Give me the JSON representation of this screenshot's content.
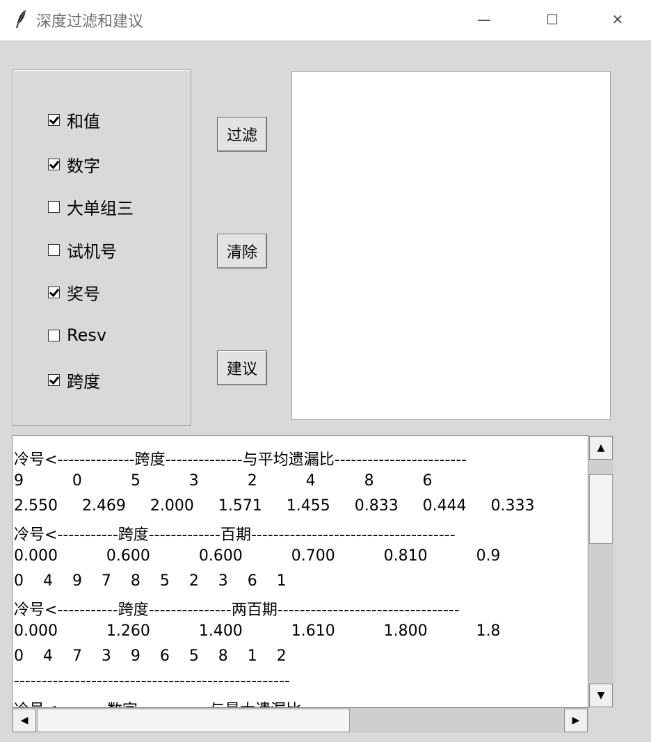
{
  "window": {
    "title": "深度过滤和建议",
    "min_symbol": "—",
    "max_symbol": "☐",
    "close_symbol": "✕",
    "icon": "feather-icon"
  },
  "options": [
    {
      "label": "和值",
      "checked": true
    },
    {
      "label": "数字",
      "checked": true
    },
    {
      "label": "大单组三",
      "checked": false
    },
    {
      "label": "试机号",
      "checked": false
    },
    {
      "label": "奖号",
      "checked": true
    },
    {
      "label": "Resv",
      "checked": false
    },
    {
      "label": "跨度",
      "checked": true
    }
  ],
  "buttons": {
    "filter": "过滤",
    "clear": "清除",
    "suggest": "建议"
  },
  "output_lines": [
    "冷号<--------------跨度--------------与平均遗漏比------------------------",
    "9          0          5          3          2          4          8          6",
    "2.550     2.469     2.000     1.571     1.455     0.833     0.444     0.333",
    "冷号<-----------跨度-------------百期-------------------------------------",
    "0.000          0.600          0.600          0.700          0.810          0.9",
    "0    4    9    7    8    5    2    3    6    1",
    "冷号<-----------跨度---------------两百期---------------------------------",
    "0.000          1.260          1.400          1.610          1.800          1.8",
    "0    4    7    3    9    6    5    8    1    2",
    "--------------------------------------------------",
    "冷号<---------数字-------------与最大遗漏比--------------------------"
  ],
  "scrollbar_arrows": {
    "up": "▲",
    "down": "▼",
    "left": "◀",
    "right": "▶"
  }
}
